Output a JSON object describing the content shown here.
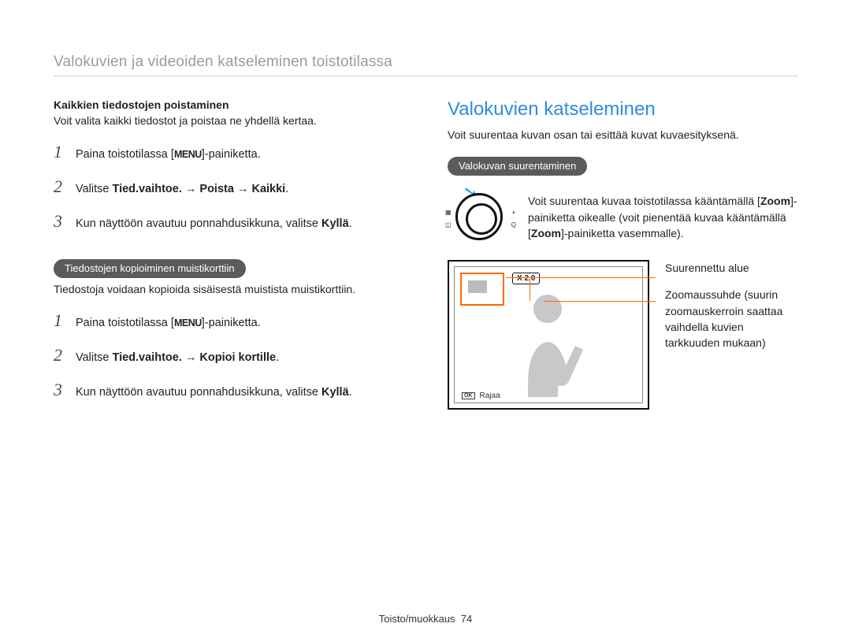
{
  "header": "Valokuvien ja videoiden katseleminen toistotilassa",
  "left": {
    "delete_all_title": "Kaikkien tiedostojen poistaminen",
    "delete_all_desc": "Voit valita kaikki tiedostot ja poistaa ne yhdellä kertaa.",
    "steps_a": {
      "s1_pre": "Paina toistotilassa [",
      "menu": "MENU",
      "s1_post": "]-painiketta.",
      "s2_pre": "Valitse  ",
      "s2_bold": "Tied.vaihtoe. → Poista → Kaikki",
      "s2_post": ".",
      "s3_pre": "Kun näyttöön avautuu ponnahdusikkuna, valitse ",
      "s3_bold": "Kyllä",
      "s3_post": "."
    },
    "copy_pill": "Tiedostojen kopioiminen muistikorttiin",
    "copy_desc": "Tiedostoja voidaan kopioida sisäisestä muistista muistikorttiin.",
    "steps_b": {
      "s1_pre": "Paina toistotilassa [",
      "menu": "MENU",
      "s1_post": "]-painiketta.",
      "s2_pre": "Valitse ",
      "s2_bold": "Tied.vaihtoe. → Kopioi kortille",
      "s2_post": ".",
      "s3_pre": "Kun näyttöön avautuu ponnahdusikkuna, valitse ",
      "s3_bold": "Kyllä",
      "s3_post": "."
    }
  },
  "right": {
    "title": "Valokuvien katseleminen",
    "intro": "Voit suurentaa kuvan osan tai esittää kuvat kuvaesityksenä.",
    "zoom_pill": "Valokuvan suurentaminen",
    "dial_text_pre": "Voit suurentaa kuvaa toistotilassa kääntämällä [",
    "zoom1": "Zoom",
    "dial_text_mid": "]-painiketta oikealle (voit pienentää kuvaa kääntämällä [",
    "zoom2": "Zoom",
    "dial_text_post": "]-painiketta vasemmalle).",
    "x20": "X 2.0",
    "ok_label": "OK",
    "rajaa": "Rajaa",
    "callout1": "Suurennettu alue",
    "callout2": "Zoomaussuhde (suurin zoomauskerroin saattaa vaihdella kuvien tarkkuuden mukaan)"
  },
  "footer_section": "Toisto/muokkaus",
  "footer_page": "74"
}
